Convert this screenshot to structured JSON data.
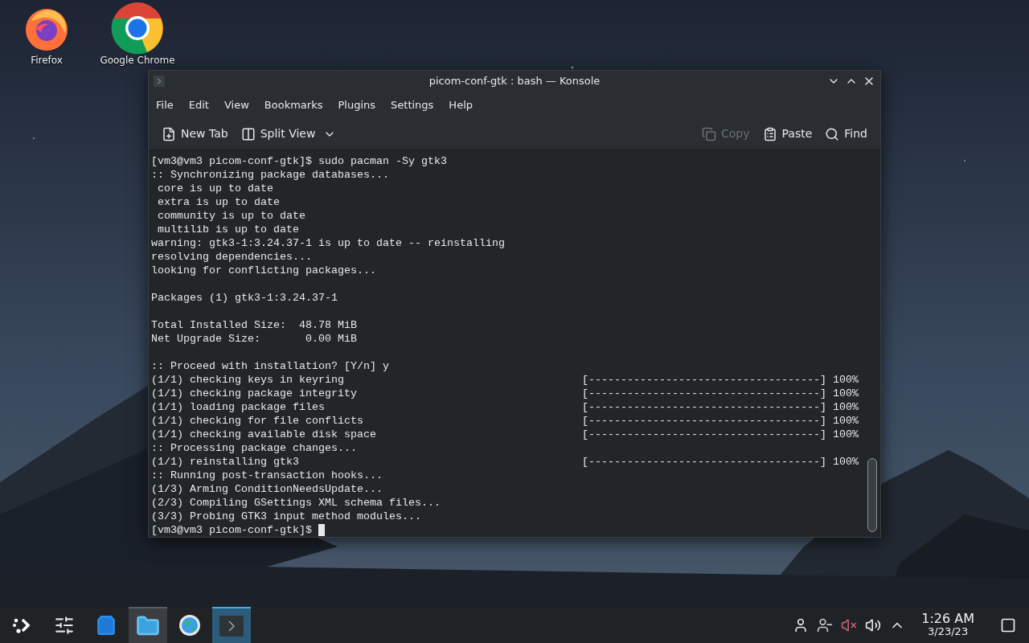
{
  "desktop_icons": [
    {
      "kind": "firefox",
      "label": "Firefox"
    },
    {
      "kind": "chrome",
      "label": "Google Chrome"
    }
  ],
  "window": {
    "title": "picom-conf-gtk : bash — Konsole",
    "menu": [
      "File",
      "Edit",
      "View",
      "Bookmarks",
      "Plugins",
      "Settings",
      "Help"
    ],
    "toolbar_left": [
      {
        "kind": "new-tab",
        "label": "New Tab",
        "disabled": false
      },
      {
        "kind": "split",
        "label": "Split View",
        "disabled": false
      }
    ],
    "toolbar_right": [
      {
        "kind": "copy",
        "label": "Copy",
        "disabled": true
      },
      {
        "kind": "paste",
        "label": "Paste",
        "disabled": false
      },
      {
        "kind": "find",
        "label": "Find",
        "disabled": false
      }
    ],
    "terminal": [
      {
        "lines": [
          {
            "text": "[vm3@vm3 picom-conf-gtk]$ sudo pacman -Sy gtk3"
          },
          {
            "text": ":: Synchronizing package databases..."
          },
          {
            "text": " core is up to date"
          },
          {
            "text": " extra is up to date"
          },
          {
            "text": " community is up to date"
          },
          {
            "text": " multilib is up to date"
          },
          {
            "text": "warning: gtk3-1:3.24.37-1 is up to date -- reinstalling"
          },
          {
            "text": "resolving dependencies..."
          },
          {
            "text": "looking for conflicting packages..."
          }
        ]
      },
      {
        "lines": [
          {
            "text": "Packages (1) gtk3-1:3.24.37-1"
          }
        ]
      },
      {
        "lines": [
          {
            "text": "Total Installed Size:  48.78 MiB"
          },
          {
            "text": "Net Upgrade Size:       0.00 MiB"
          }
        ]
      },
      {
        "lines": [
          {
            "text": ":: Proceed with installation? [Y/n] y"
          },
          {
            "text": "(1/1) checking keys in keyring",
            "progress": "[------------------------------------] 100%"
          },
          {
            "text": "(1/1) checking package integrity",
            "progress": "[------------------------------------] 100%"
          },
          {
            "text": "(1/1) loading package files",
            "progress": "[------------------------------------] 100%"
          },
          {
            "text": "(1/1) checking for file conflicts",
            "progress": "[------------------------------------] 100%"
          },
          {
            "text": "(1/1) checking available disk space",
            "progress": "[------------------------------------] 100%"
          },
          {
            "text": ":: Processing package changes..."
          },
          {
            "text": "(1/1) reinstalling gtk3",
            "progress": "[------------------------------------] 100%"
          },
          {
            "text": ":: Running post-transaction hooks..."
          },
          {
            "text": "(1/3) Arming ConditionNeedsUpdate..."
          },
          {
            "text": "(2/3) Compiling GSettings XML schema files..."
          },
          {
            "text": "(3/3) Probing GTK3 input method modules..."
          },
          {
            "text": "[vm3@vm3 picom-conf-gtk]$ ",
            "cursor": true
          }
        ]
      }
    ]
  },
  "taskbar": {
    "items": [
      {
        "kind": "launcher",
        "selected": false,
        "hovered": false
      },
      {
        "kind": "settings",
        "selected": false,
        "hovered": false
      },
      {
        "kind": "store",
        "selected": false,
        "hovered": false
      },
      {
        "kind": "files",
        "selected": false,
        "hovered": true
      },
      {
        "kind": "globe",
        "selected": false,
        "hovered": false
      },
      {
        "kind": "terminal",
        "selected": true,
        "hovered": false
      }
    ],
    "tray": [
      {
        "kind": "user"
      },
      {
        "kind": "user-minus"
      },
      {
        "kind": "muted"
      },
      {
        "kind": "volume"
      },
      {
        "kind": "up"
      }
    ],
    "time": "1:26 AM",
    "date": "3/23/23"
  }
}
